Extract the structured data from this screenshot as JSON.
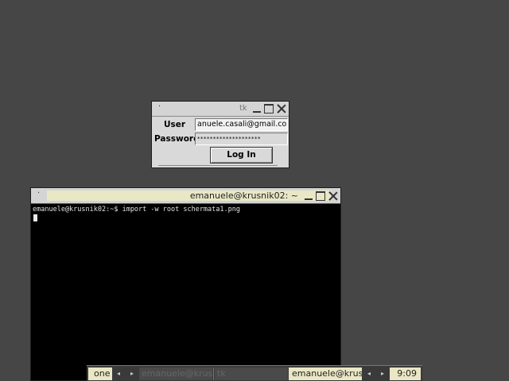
{
  "login_window": {
    "menu_glyph": "·",
    "title": "tk",
    "user_label": "User",
    "user_value": "anuele.casali@gmail.com",
    "password_label": "Password",
    "password_value": "********************",
    "login_button": "Log In"
  },
  "terminal_window": {
    "title": "emanuele@krusnik02: ~",
    "command_line": "emanuele@krusnik02:~$ import -w root schermata1.png"
  },
  "taskbar": {
    "desktop_name": "one",
    "prev_arrow": "◂",
    "next_arrow": "▸",
    "tasks": [
      {
        "label": "emanuele@krus",
        "active": false
      },
      {
        "label": "tk",
        "active": false
      },
      {
        "label": "emanuele@krus",
        "active": true
      }
    ],
    "clock": "9:09"
  },
  "colors": {
    "desktop_bg": "#464646",
    "title_highlight": "#e9e7c5",
    "terminal_bg": "#000000",
    "dialog_bg": "#d9d9d9"
  }
}
